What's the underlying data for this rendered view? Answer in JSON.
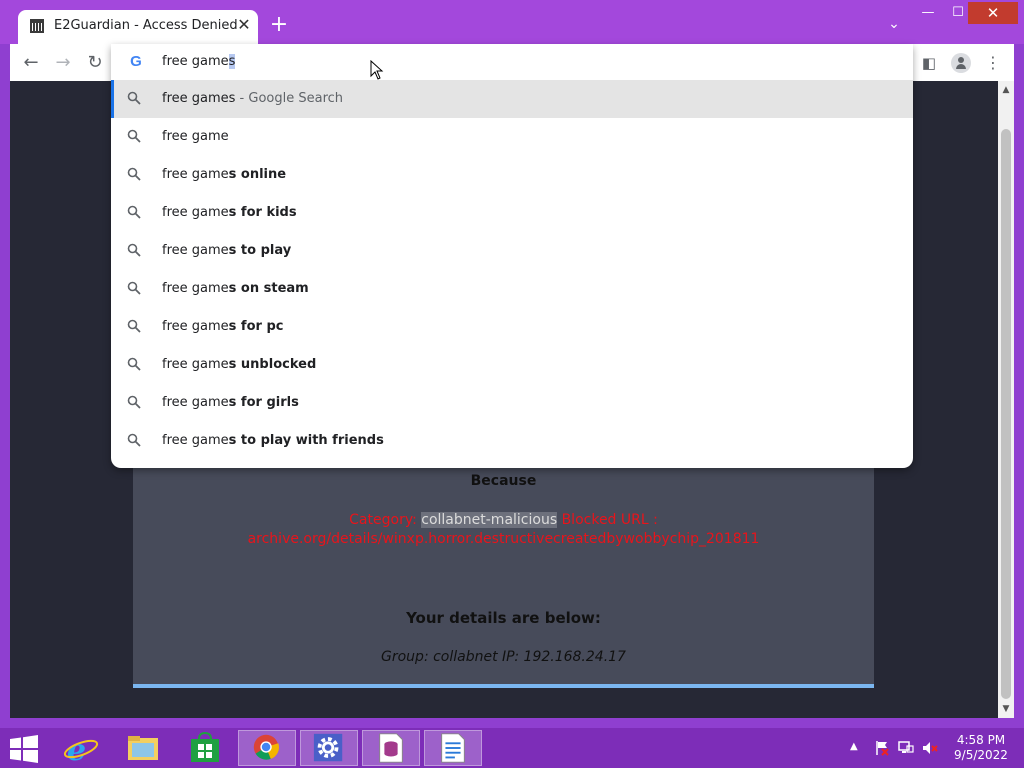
{
  "browser": {
    "tab_title": "E2Guardian - Access Denied",
    "tab_close": "✕",
    "new_tab": "+",
    "tab_search": "⌄",
    "win_minimize": "—",
    "win_maximize": "☐",
    "win_close": "✕"
  },
  "toolbar": {
    "back": "←",
    "forward": "→",
    "reload": "↻",
    "side_panel": "◧",
    "menu": "⋮"
  },
  "omnibox": {
    "typed": "free game",
    "autocomplete": "s",
    "suggestions": [
      {
        "base": "free games",
        "bold": "",
        "hint": " - Google Search"
      },
      {
        "base": "free game",
        "bold": "",
        "hint": ""
      },
      {
        "base": "free game",
        "bold": "s online",
        "hint": ""
      },
      {
        "base": "free game",
        "bold": "s for kids",
        "hint": ""
      },
      {
        "base": "free game",
        "bold": "s to play",
        "hint": ""
      },
      {
        "base": "free game",
        "bold": "s on steam",
        "hint": ""
      },
      {
        "base": "free game",
        "bold": "s for pc",
        "hint": ""
      },
      {
        "base": "free game",
        "bold": "s unblocked",
        "hint": ""
      },
      {
        "base": "free game",
        "bold": "s for girls",
        "hint": ""
      },
      {
        "base": "free game",
        "bold": "s to play with friends",
        "hint": ""
      }
    ]
  },
  "page": {
    "because": "Because",
    "category_label": "Category: ",
    "category_value": "collabnet-malicious",
    "blocked_label": "  Blocked URL :",
    "blocked_url": "archive.org/details/winxp.horror.destructivecreatedbywobbychip_201811",
    "details_heading": "Your details are below:",
    "group_line": "Group: collabnet   IP: 192.168.24.17"
  },
  "taskbar": {
    "clock_time": "4:58 PM",
    "clock_date": "9/5/2022",
    "tray_arrow": "▲"
  },
  "colors": {
    "accent": "#a348dc",
    "blocked_text": "#e8141b",
    "page_bg": "#262835"
  }
}
